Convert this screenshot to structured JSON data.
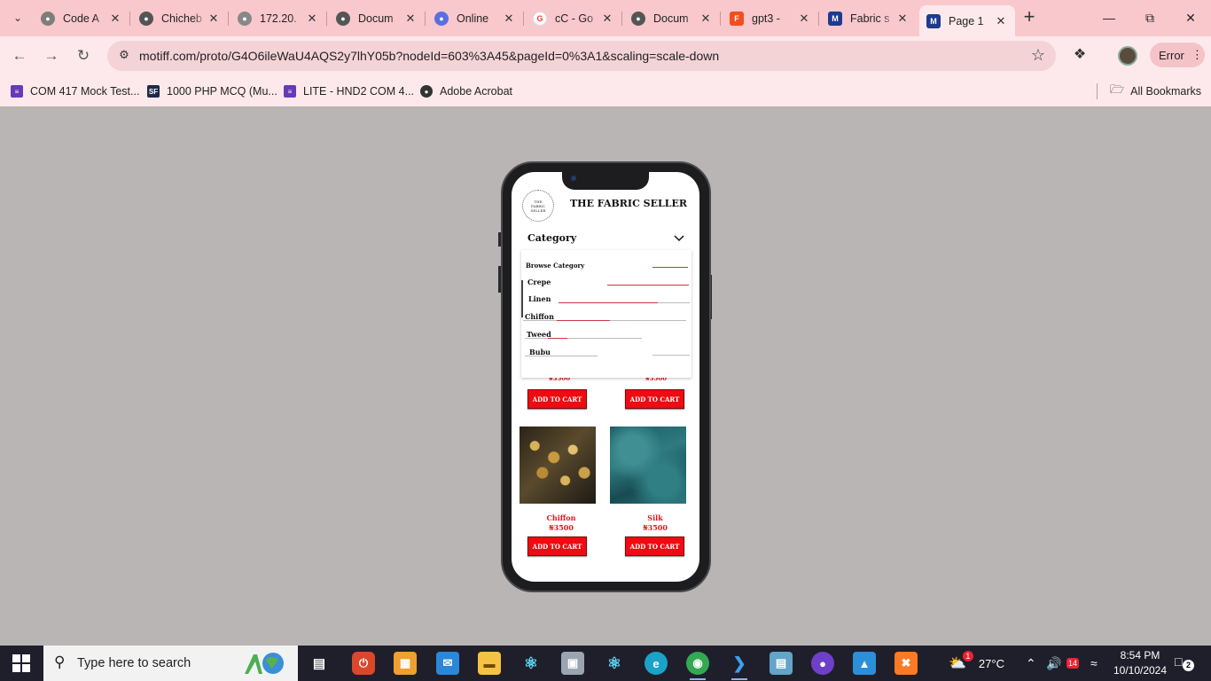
{
  "browser": {
    "tabs": [
      {
        "title": "Code A",
        "favicon": "chrome-icon",
        "color": "#7d7d7d"
      },
      {
        "title": "Chicheb",
        "favicon": "web-icon",
        "color": "#555555"
      },
      {
        "title": "172.20.",
        "favicon": "web-icon",
        "color": "#888888"
      },
      {
        "title": "Docum",
        "favicon": "web-icon",
        "color": "#555555"
      },
      {
        "title": "Online",
        "favicon": "online-icon",
        "color": "#5b6ee1"
      },
      {
        "title": "cC - Go",
        "favicon": "google-icon",
        "color": "#ea4335"
      },
      {
        "title": "Docum",
        "favicon": "web-icon",
        "color": "#555555"
      },
      {
        "title": "gpt3 -",
        "favicon": "figma-icon",
        "color": "#f24e1e"
      },
      {
        "title": "Fabric s",
        "favicon": "motiff-icon",
        "color": "#1d3b8f"
      },
      {
        "title": "Page 1",
        "favicon": "motiff-icon",
        "color": "#1d3b8f"
      }
    ],
    "url": "motiff.com/proto/G4O6ileWaU4AQS2y7lhY05b?nodeId=603%3A45&pageId=0%3A1&scaling=scale-down",
    "error_label": "Error",
    "bookmarks": [
      {
        "label": "COM 417 Mock Test...",
        "icon": "forms-icon",
        "color": "#673ab7"
      },
      {
        "label": "1000 PHP MCQ (Mu...",
        "icon": "sanfoundry-icon",
        "color": "#1a2a4a"
      },
      {
        "label": "LITE - HND2 COM 4...",
        "icon": "forms-icon",
        "color": "#673ab7"
      },
      {
        "label": "Adobe Acrobat",
        "icon": "web-icon",
        "color": "#333333"
      }
    ],
    "all_bookmarks": "All Bookmarks"
  },
  "app": {
    "logo_text": [
      "THE",
      "FABRIC",
      "SELLER"
    ],
    "brand": "THE FABRIC SELLER",
    "category_label": "Category",
    "dropdown": {
      "items": [
        "Browse Category",
        "Crepe",
        "Linen",
        "Chiffon",
        "Tweed",
        "Bubu"
      ]
    },
    "top_prices": [
      "₦3500",
      "₦3500"
    ],
    "products": [
      {
        "name": "Chiffon",
        "price": "₦3500",
        "button": "ADD TO CART"
      },
      {
        "name": "Silk",
        "price": "₦3500",
        "button": "ADD TO CART"
      }
    ],
    "top_buttons": [
      "ADD TO CART",
      "ADD TO CART"
    ]
  },
  "taskbar": {
    "search_placeholder": "Type here to search",
    "weather": "27°C",
    "weather_badge": "1",
    "time": "8:54 PM",
    "date": "10/10/2024",
    "notification_count": "2",
    "calendar_badge": "14",
    "apps": [
      {
        "name": "task-view-icon",
        "color": "#1f1f2b"
      },
      {
        "name": "app-red-icon",
        "color": "#d9482b"
      },
      {
        "name": "store-icon",
        "color": "#f0a030"
      },
      {
        "name": "mail-icon",
        "color": "#2b88d8"
      },
      {
        "name": "file-explorer-icon",
        "color": "#f5c243"
      },
      {
        "name": "react-icon",
        "color": "#1f1f2b"
      },
      {
        "name": "photos-icon",
        "color": "#9aa5b1"
      },
      {
        "name": "react-native-icon",
        "color": "#1f1f2b"
      },
      {
        "name": "edge-icon",
        "color": "#1aa2c8"
      },
      {
        "name": "chrome-icon",
        "color": "#34a853"
      },
      {
        "name": "vscode-icon",
        "color": "#1f1f2b"
      },
      {
        "name": "notepad-icon",
        "color": "#63a4c8"
      },
      {
        "name": "github-icon",
        "color": "#6e40c9"
      },
      {
        "name": "paint-icon",
        "color": "#2d8fd8"
      },
      {
        "name": "xampp-icon",
        "color": "#fb7a24"
      }
    ]
  }
}
